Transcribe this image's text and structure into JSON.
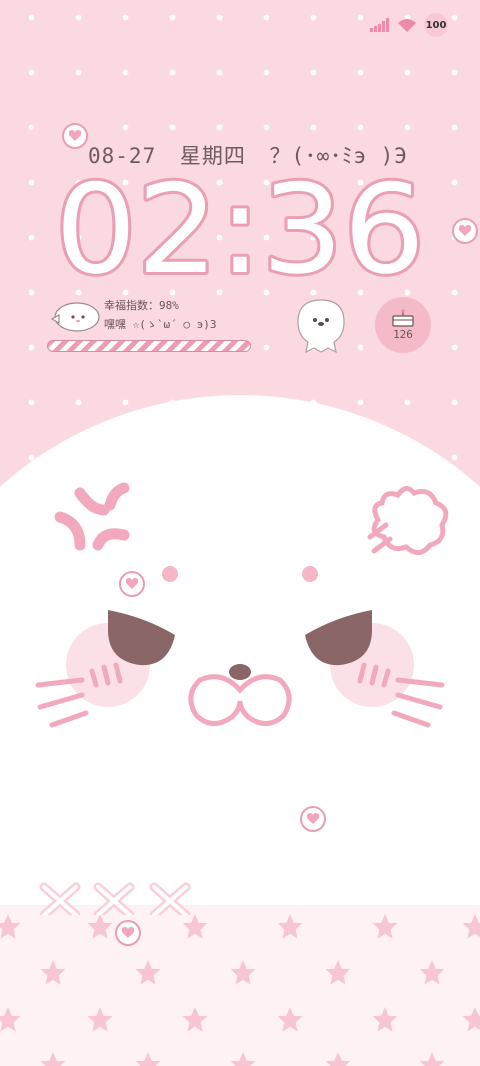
{
  "status": {
    "battery_level": "100",
    "signal_icon": "signal-icon",
    "wifi_icon": "wifi-icon"
  },
  "lockscreen": {
    "date": "08-27",
    "weekday": "星期四",
    "kaomoji_top": "？(･∞･ﾐэ )Э",
    "time": "02:36",
    "happiness_label": "幸福指数：98%",
    "happiness_percent": 98,
    "greeting": "嘿嘿 ☆(ゝ`ω´ ○ э)3",
    "cake_count": "126"
  },
  "theme": {
    "pink": "#fbd9e0",
    "accent": "#ea9fb4",
    "text": "#6e5a5c",
    "white": "#ffffff"
  }
}
